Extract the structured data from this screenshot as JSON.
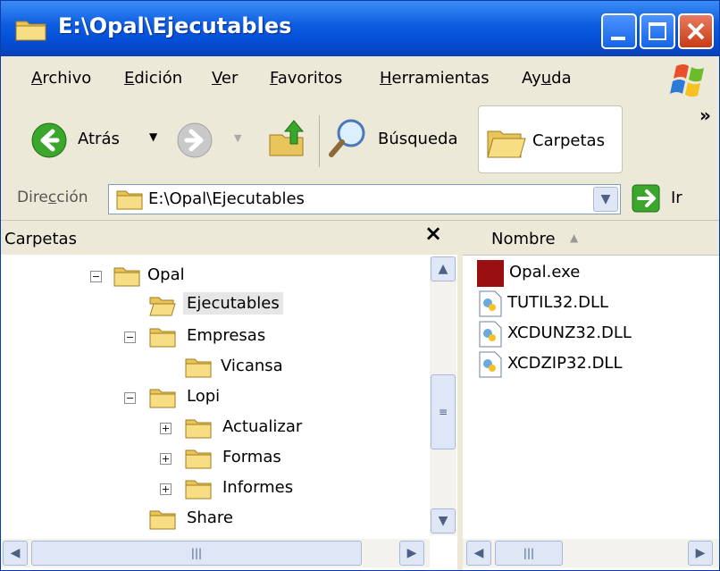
{
  "window": {
    "title": "E:\\Opal\\Ejecutables"
  },
  "menu": {
    "items": [
      {
        "label": "Archivo",
        "underline": "A",
        "rest": "rchivo"
      },
      {
        "label": "Edición",
        "underline": "E",
        "rest": "dición"
      },
      {
        "label": "Ver",
        "underline": "V",
        "rest": "er"
      },
      {
        "label": "Favoritos",
        "underline": "F",
        "rest": "avoritos"
      },
      {
        "label": "Herramientas",
        "underline": "H",
        "rest": "erramientas"
      },
      {
        "label": "Ayuda",
        "pre": "Ay",
        "underline": "u",
        "rest": "da"
      }
    ]
  },
  "toolbar": {
    "back_label": "Atrás",
    "search_label": "Búsqueda",
    "folders_label": "Carpetas",
    "overflow": "»"
  },
  "address": {
    "label_pre": "Dire",
    "label_u": "c",
    "label_post": "ción",
    "value": "E:\\Opal\\Ejecutables",
    "go_label": "Ir"
  },
  "folders_pane": {
    "title": "Carpetas",
    "close": "×",
    "tree": [
      {
        "label": "Opal",
        "expander": "minus"
      },
      {
        "label": "Ejecutables",
        "expander": "none",
        "selected": true
      },
      {
        "label": "Empresas",
        "expander": "minus"
      },
      {
        "label": "Vicansa",
        "expander": "none"
      },
      {
        "label": "Lopi",
        "expander": "minus"
      },
      {
        "label": "Actualizar",
        "expander": "plus"
      },
      {
        "label": "Formas",
        "expander": "plus"
      },
      {
        "label": "Informes",
        "expander": "plus"
      },
      {
        "label": "Share",
        "expander": "none"
      }
    ]
  },
  "files_pane": {
    "column_header": "Nombre",
    "files": [
      {
        "name": "Opal.exe",
        "icon": "exe-icon"
      },
      {
        "name": "TUTIL32.DLL",
        "icon": "dll-icon"
      },
      {
        "name": "XCDUNZ32.DLL",
        "icon": "dll-icon"
      },
      {
        "name": "XCDZIP32.DLL",
        "icon": "dll-icon"
      }
    ]
  },
  "colors": {
    "titlebar": "#0450d8",
    "selection": "#e6e6e6",
    "chrome": "#ece9d8"
  }
}
